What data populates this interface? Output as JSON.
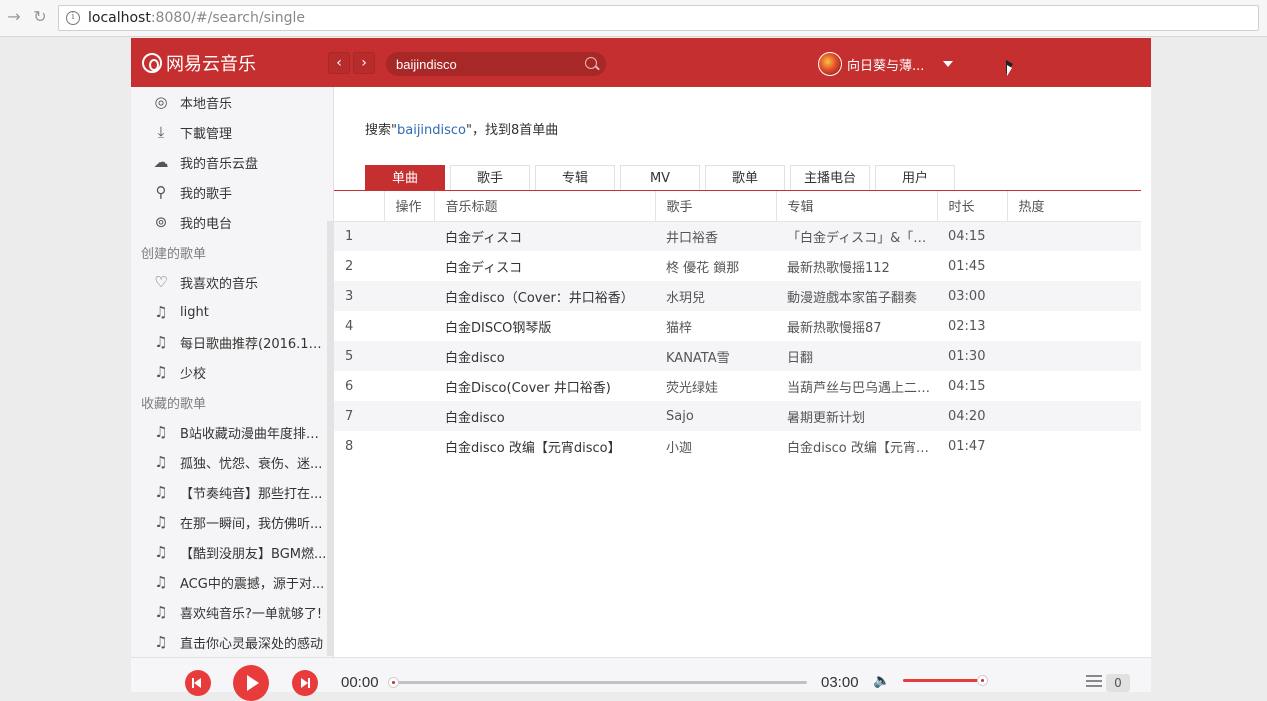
{
  "browser": {
    "url_host": "localhost",
    "url_rest": ":8080/#/search/single"
  },
  "header": {
    "logo_text": "网易云音乐",
    "back_icon": "chevron-left-icon",
    "forward_icon": "chevron-right-icon",
    "search_value": "baijindisco",
    "username": "向日葵与薄..."
  },
  "sidebar": {
    "items": [
      {
        "label": "本地音乐",
        "icon": "music-disc-icon"
      },
      {
        "label": "下載管理",
        "icon": "download-icon"
      },
      {
        "label": "我的音乐云盘",
        "icon": "cloud-icon"
      },
      {
        "label": "我的歌手",
        "icon": "person-icon"
      },
      {
        "label": "我的电台",
        "icon": "radio-icon"
      }
    ],
    "created_heading": "创建的歌单",
    "created": [
      {
        "label": "我喜欢的音乐",
        "icon": "heart-icon"
      },
      {
        "label": "light",
        "icon": "playlist-icon"
      },
      {
        "label": "每日歌曲推荐(2016.11...",
        "icon": "playlist-icon"
      },
      {
        "label": "少校",
        "icon": "playlist-icon"
      }
    ],
    "collected_heading": "收藏的歌单",
    "collected": [
      {
        "label": "B站收藏动漫曲年度排行...",
        "icon": "playlist-icon"
      },
      {
        "label": "孤独、忧怨、衰伤、迷...",
        "icon": "playlist-icon"
      },
      {
        "label": "【节奏纯音】那些打在...",
        "icon": "playlist-icon"
      },
      {
        "label": "在那一瞬间，我仿佛听...",
        "icon": "playlist-icon"
      },
      {
        "label": "【酷到没朋友】BGM燃...",
        "icon": "playlist-icon"
      },
      {
        "label": "ACG中的震撼，源于对...",
        "icon": "playlist-icon"
      },
      {
        "label": "喜欢纯音乐?一单就够了!",
        "icon": "playlist-icon"
      },
      {
        "label": "直击你心灵最深处的感动",
        "icon": "playlist-icon"
      }
    ]
  },
  "search_result": {
    "prefix": "搜索\"",
    "keyword": "baijindisco",
    "suffix": "\"，找到8首单曲"
  },
  "tabs": [
    "单曲",
    "歌手",
    "专辑",
    "MV",
    "歌单",
    "主播电台",
    "用户"
  ],
  "table": {
    "headers": [
      "",
      "操作",
      "音乐标题",
      "歌手",
      "专辑",
      "时长",
      "热度"
    ],
    "rows": [
      {
        "no": "1",
        "title": "白金ディスコ",
        "artist": "井口裕香",
        "album": "「白金ディスコ」&「偽物...",
        "duration": "04:15"
      },
      {
        "no": "2",
        "title": "白金ディスコ",
        "artist": "柊 優花 鎖那",
        "album": "最新热歌慢摇112",
        "duration": "01:45"
      },
      {
        "no": "3",
        "title": "白金disco（Cover：井口裕香）",
        "artist": "水玥兒",
        "album": "動漫遊戲本家笛子翻奏",
        "duration": "03:00"
      },
      {
        "no": "4",
        "title": "白金DISCO钢琴版",
        "artist": "猫梓",
        "album": "最新热歌慢摇87",
        "duration": "02:13"
      },
      {
        "no": "5",
        "title": "白金disco",
        "artist": "KANATA雪",
        "album": "日翻",
        "duration": "01:30"
      },
      {
        "no": "6",
        "title": "白金Disco(Cover 井口裕香)",
        "artist": "荧光绿娃",
        "album": "当葫芦丝与巴乌遇上二次...",
        "duration": "04:15"
      },
      {
        "no": "7",
        "title": "白金disco",
        "artist": "Sajo",
        "album": "暑期更新计划",
        "duration": "04:20"
      },
      {
        "no": "8",
        "title": "白金disco 改编【元宵disco】",
        "artist": "小迦",
        "album": "白金disco 改编【元宵di...",
        "duration": "01:47"
      }
    ]
  },
  "player": {
    "current_time": "00:00",
    "total_time": "03:00",
    "progress": 0,
    "volume": 0.95,
    "queue_count": "0"
  },
  "colors": {
    "brand": "#c62f2f",
    "link": "#2f6bb5",
    "player_red": "#e83c3c"
  }
}
